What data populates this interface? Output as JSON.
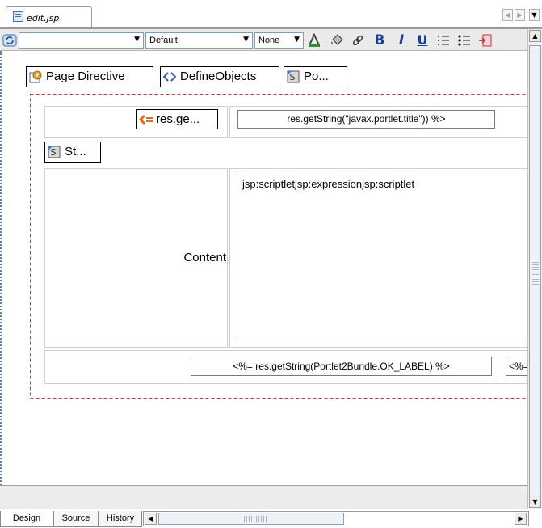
{
  "editor_tab": {
    "title": "edit.jsp",
    "icon": "jsp-file-icon"
  },
  "tab_nav": {
    "left": "◀",
    "right": "▶",
    "menu": "▼"
  },
  "toolbar": {
    "style_combo": {
      "value": ""
    },
    "font_combo": {
      "value": "Default"
    },
    "size_combo": {
      "value": "None"
    },
    "bold_label": "B",
    "italic_label": "I",
    "underline_label": "U"
  },
  "canvas": {
    "directives": [
      {
        "label": "Page Directive",
        "icon": "page-directive-icon"
      },
      {
        "label": "DefineObjects",
        "icon": "define-objects-icon"
      },
      {
        "label": "Po...",
        "icon": "scriptlet-icon"
      }
    ],
    "title_expression_button": "res.ge...",
    "title_expression_text": "res.getString(\"javax.portlet.title\")) %>",
    "scriptlet_button": "St...",
    "content_label": "Content",
    "content_text": "jsp:scriptletjsp:expressionjsp:scriptlet",
    "ok_expression": "<%= res.getString(Portlet2Bundle.OK_LABEL) %>",
    "ok_expression_cut": "<%="
  },
  "bottom_tabs": [
    "Design",
    "Source",
    "History"
  ],
  "colors": {
    "selection_border": "#cc3333",
    "toolbar_bg": "#eaeaea",
    "scrollbar_thumb": "#eef1f6"
  }
}
